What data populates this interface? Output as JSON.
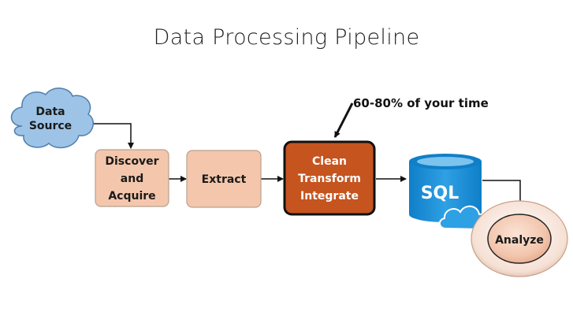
{
  "title": "Data Processing Pipeline",
  "nodes": {
    "data_source": {
      "line1": "Data",
      "line2": "Source"
    },
    "discover": {
      "line1": "Discover",
      "line2": "and",
      "line3": "Acquire"
    },
    "extract": {
      "label": "Extract"
    },
    "clean": {
      "line1": "Clean",
      "line2": "Transform",
      "line3": "Integrate"
    },
    "sql": {
      "label": "SQL"
    },
    "analyze": {
      "label": "Analyze"
    }
  },
  "annotation": "60-80% of your time",
  "colors": {
    "cloud_fill": "#9dc3e6",
    "box_fill": "#f4c7ac",
    "clean_fill": "#c5541f",
    "sql_blue": "#1d8fd6",
    "analyze_fill": "#f2c5ad"
  }
}
